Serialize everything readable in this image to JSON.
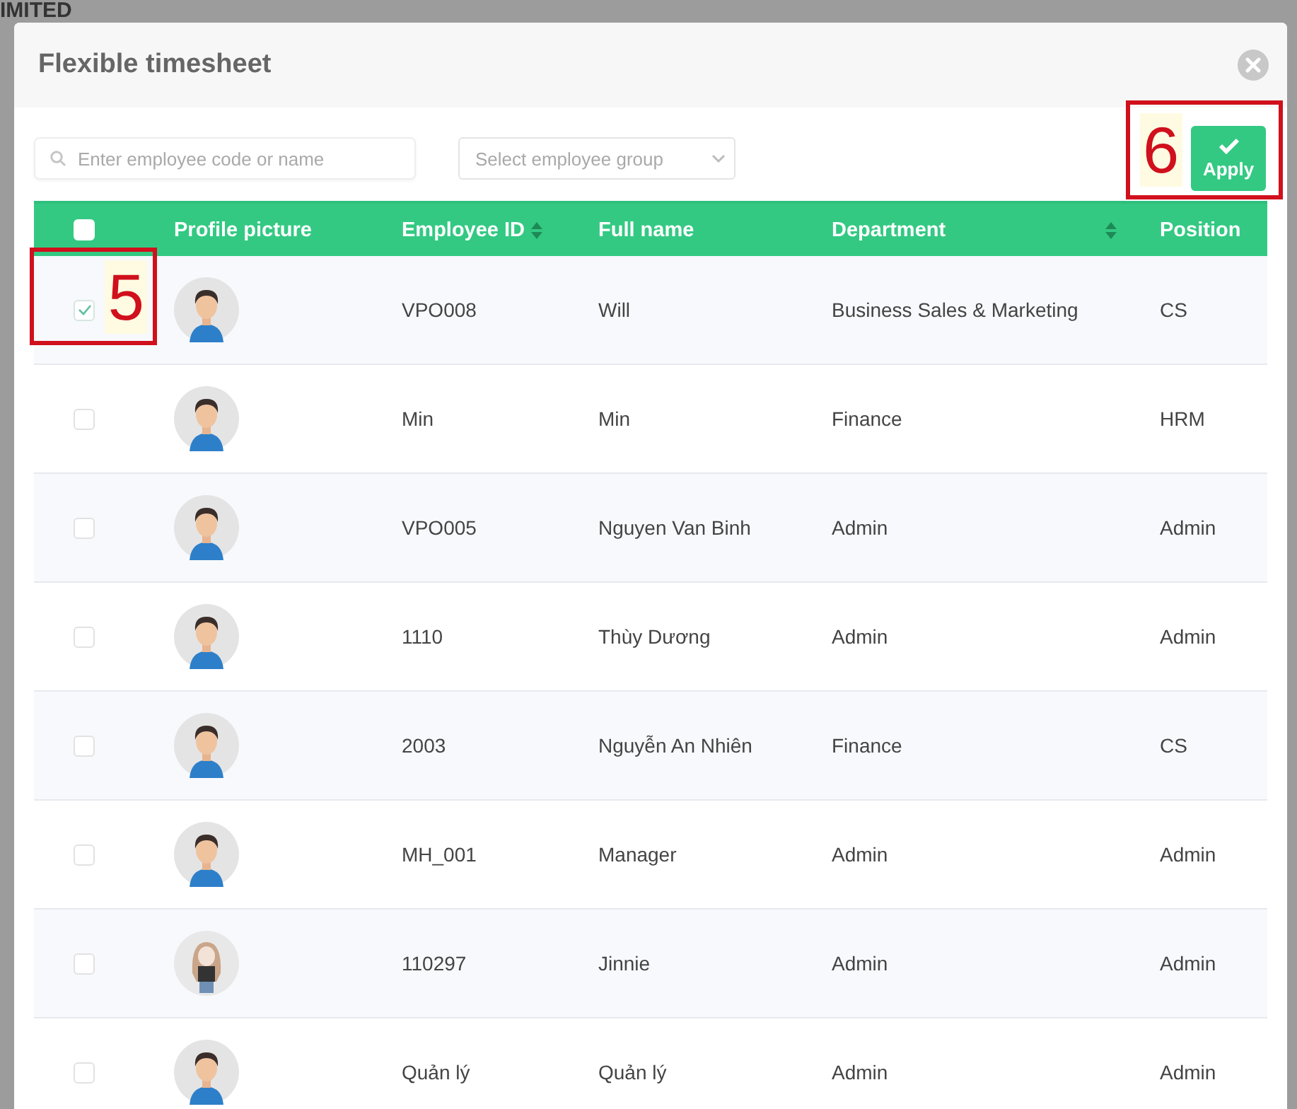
{
  "backdrop": {
    "heading": "IMITED"
  },
  "dialog": {
    "title": "Flexible timesheet"
  },
  "toolbar": {
    "search": {
      "placeholder": "Enter employee code or name"
    },
    "group_select": {
      "placeholder": "Select employee group"
    },
    "apply_button": {
      "label": "Apply"
    }
  },
  "table": {
    "select_all": {
      "checked": false
    },
    "columns": [
      {
        "label": "Profile picture",
        "sortable": false
      },
      {
        "label": "Employee ID",
        "sortable": true
      },
      {
        "label": "Full name",
        "sortable": false
      },
      {
        "label": "Department",
        "sortable": true
      },
      {
        "label": "Position",
        "sortable": false
      }
    ],
    "rows": [
      {
        "checked": true,
        "has_photo": false,
        "employee_id": "VPO008",
        "full_name": "Will",
        "department": "Business Sales & Marketing",
        "position": "CS"
      },
      {
        "checked": false,
        "has_photo": false,
        "employee_id": "Min",
        "full_name": "Min",
        "department": "Finance",
        "position": "HRM"
      },
      {
        "checked": false,
        "has_photo": false,
        "employee_id": "VPO005",
        "full_name": "Nguyen Van Binh",
        "department": "Admin",
        "position": "Admin"
      },
      {
        "checked": false,
        "has_photo": false,
        "employee_id": "1110",
        "full_name": "Thùy Dương",
        "department": "Admin",
        "position": "Admin"
      },
      {
        "checked": false,
        "has_photo": false,
        "employee_id": "2003",
        "full_name": "Nguyễn An Nhiên",
        "department": "Finance",
        "position": "CS"
      },
      {
        "checked": false,
        "has_photo": false,
        "employee_id": "MH_001",
        "full_name": "Manager",
        "department": "Admin",
        "position": "Admin"
      },
      {
        "checked": false,
        "has_photo": true,
        "employee_id": "110297",
        "full_name": "Jinnie",
        "department": "Admin",
        "position": "Admin"
      },
      {
        "checked": false,
        "has_photo": false,
        "employee_id": "Quản lý",
        "full_name": "Quản lý",
        "department": "Admin",
        "position": "Admin"
      }
    ]
  },
  "annotations": [
    {
      "label": "5"
    },
    {
      "label": "6"
    }
  ]
}
